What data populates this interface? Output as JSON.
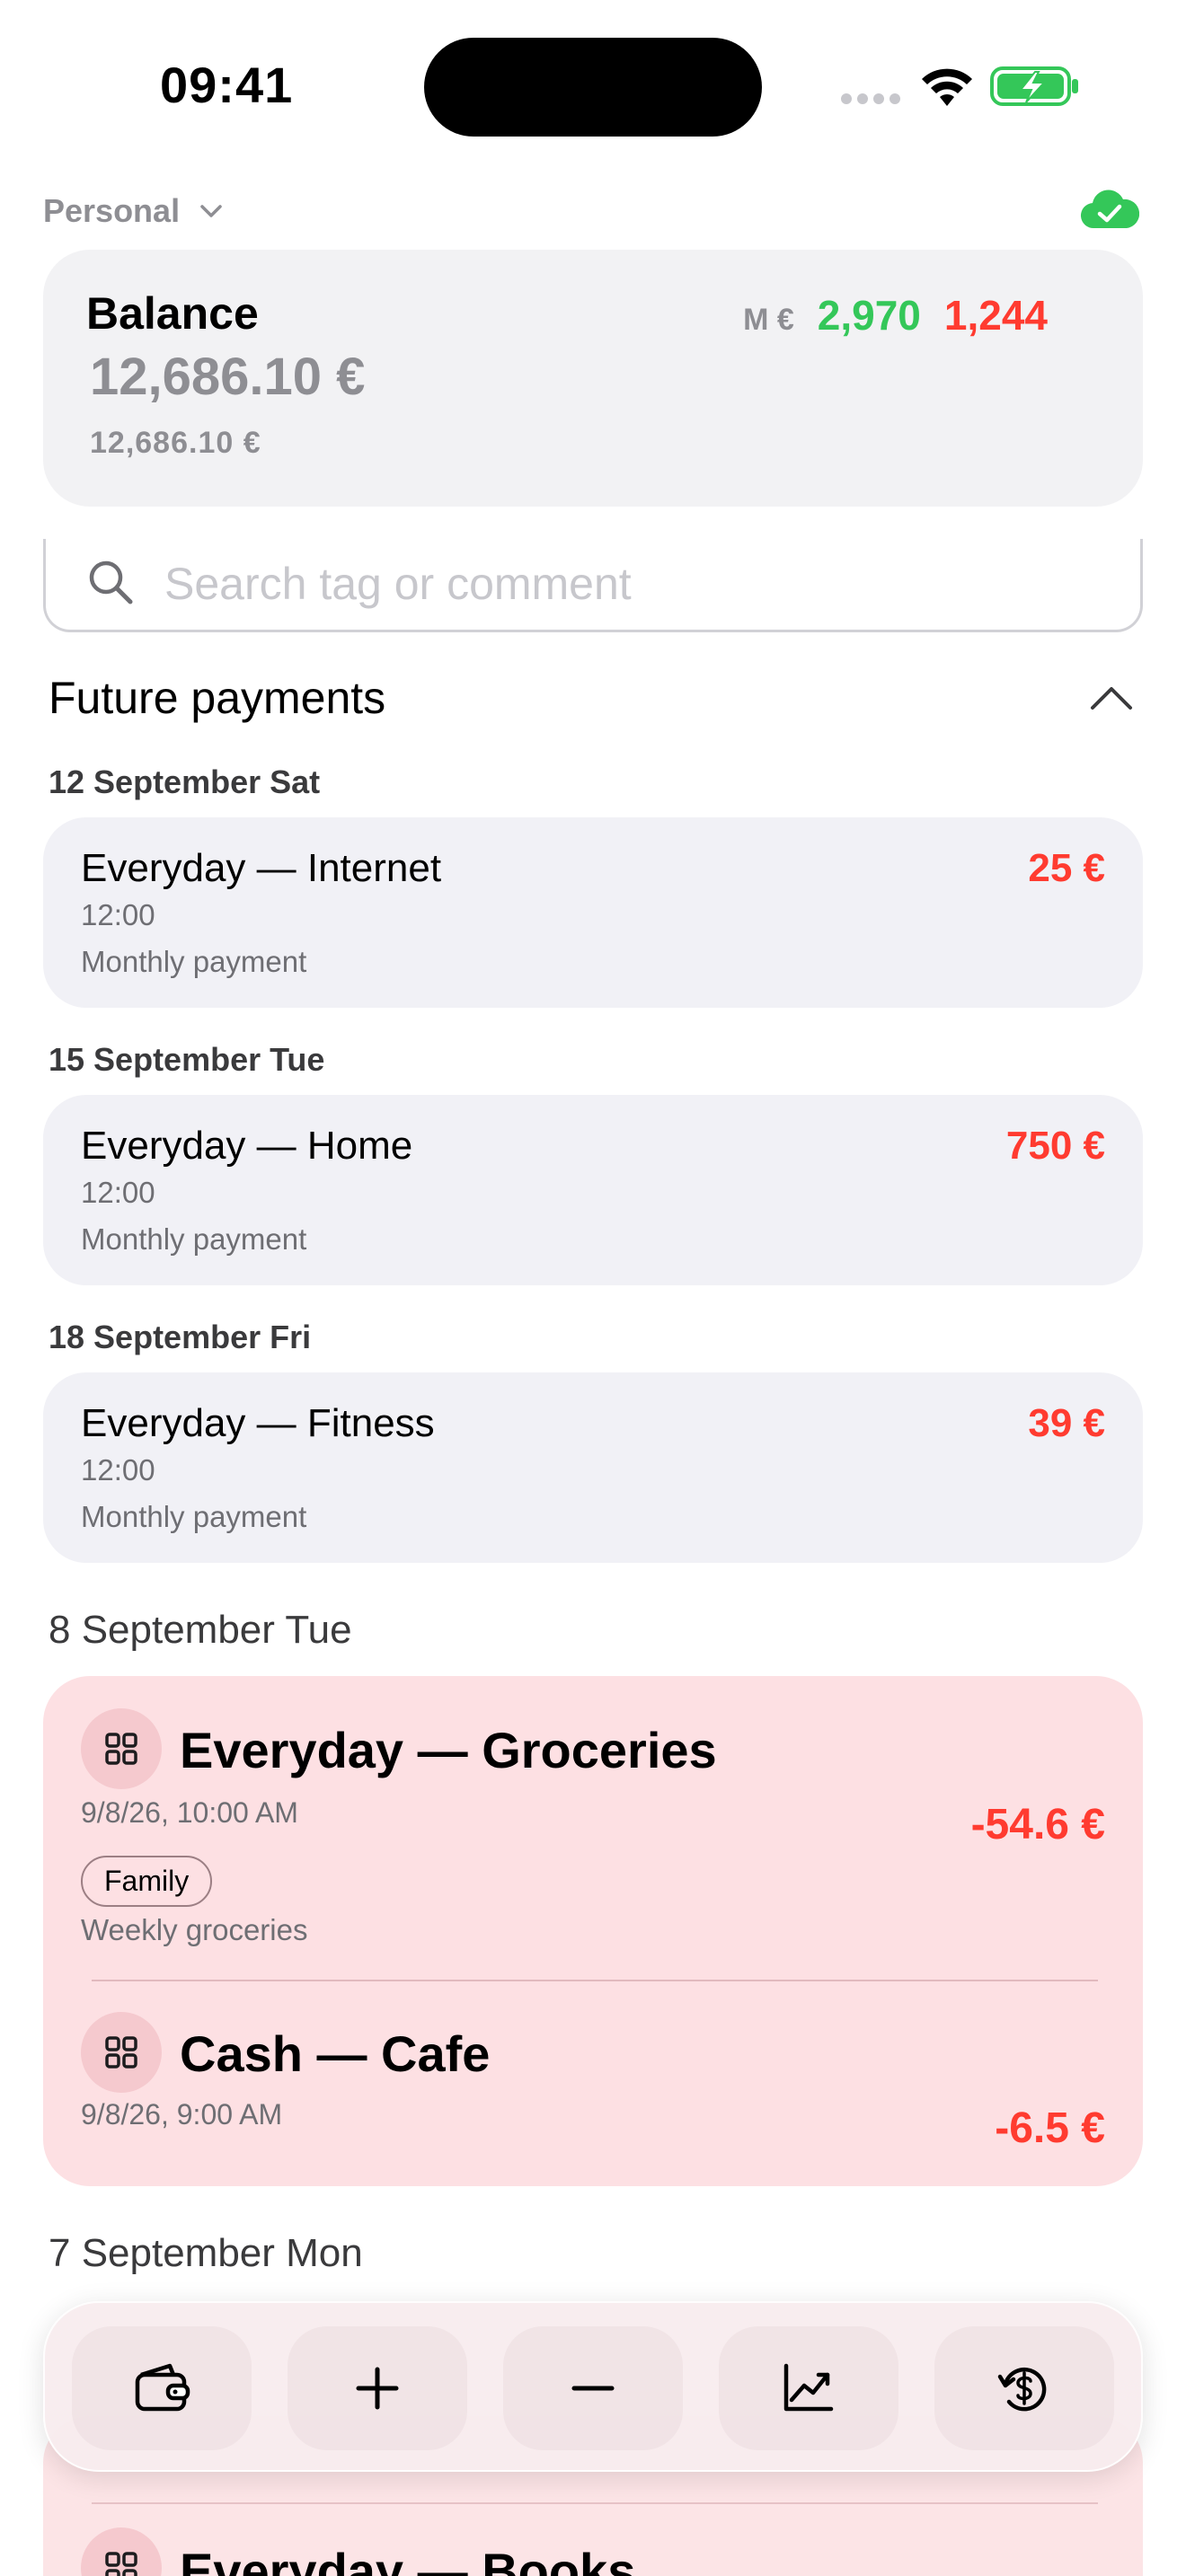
{
  "status_bar": {
    "time": "09:41"
  },
  "header": {
    "account": "Personal"
  },
  "balance": {
    "title": "Balance",
    "amount": "12,686.10 €",
    "sub_amount": "12,686.10 €",
    "month_label": "M €",
    "income": "2,970",
    "expense": "1,244"
  },
  "search": {
    "placeholder": "Search tag or comment"
  },
  "future_payments": {
    "title": "Future payments",
    "items": [
      {
        "date": "12 September Sat",
        "name": "Everyday — Internet",
        "time": "12:00",
        "note": "Monthly payment",
        "amount": "25 €"
      },
      {
        "date": "15 September Tue",
        "name": "Everyday — Home",
        "time": "12:00",
        "note": "Monthly payment",
        "amount": "750 €"
      },
      {
        "date": "18 September Fri",
        "name": "Everyday — Fitness",
        "time": "12:00",
        "note": "Monthly payment",
        "amount": "39 €"
      }
    ]
  },
  "days": [
    {
      "title": "8 September Tue",
      "transactions": [
        {
          "name": "Everyday — Groceries",
          "datetime": "9/8/26, 10:00 AM",
          "tag": "Family",
          "note": "Weekly groceries",
          "amount": "-54.6 €"
        },
        {
          "name": "Cash — Cafe",
          "datetime": "9/8/26, 9:00 AM",
          "amount": "-6.5 €"
        }
      ]
    },
    {
      "title": "7 September Mon",
      "transactions": [
        {
          "name": "Everyday — Books"
        }
      ]
    }
  ],
  "colors": {
    "income": "#34c759",
    "expense": "#ff3b30",
    "card": "#f1f1f6",
    "expense_group": "#fde0e3"
  },
  "tab_bar": {
    "items": [
      {
        "icon": "wallet-icon"
      },
      {
        "icon": "plus-icon"
      },
      {
        "icon": "minus-icon"
      },
      {
        "icon": "chart-icon"
      },
      {
        "icon": "currency-history-icon"
      }
    ]
  }
}
